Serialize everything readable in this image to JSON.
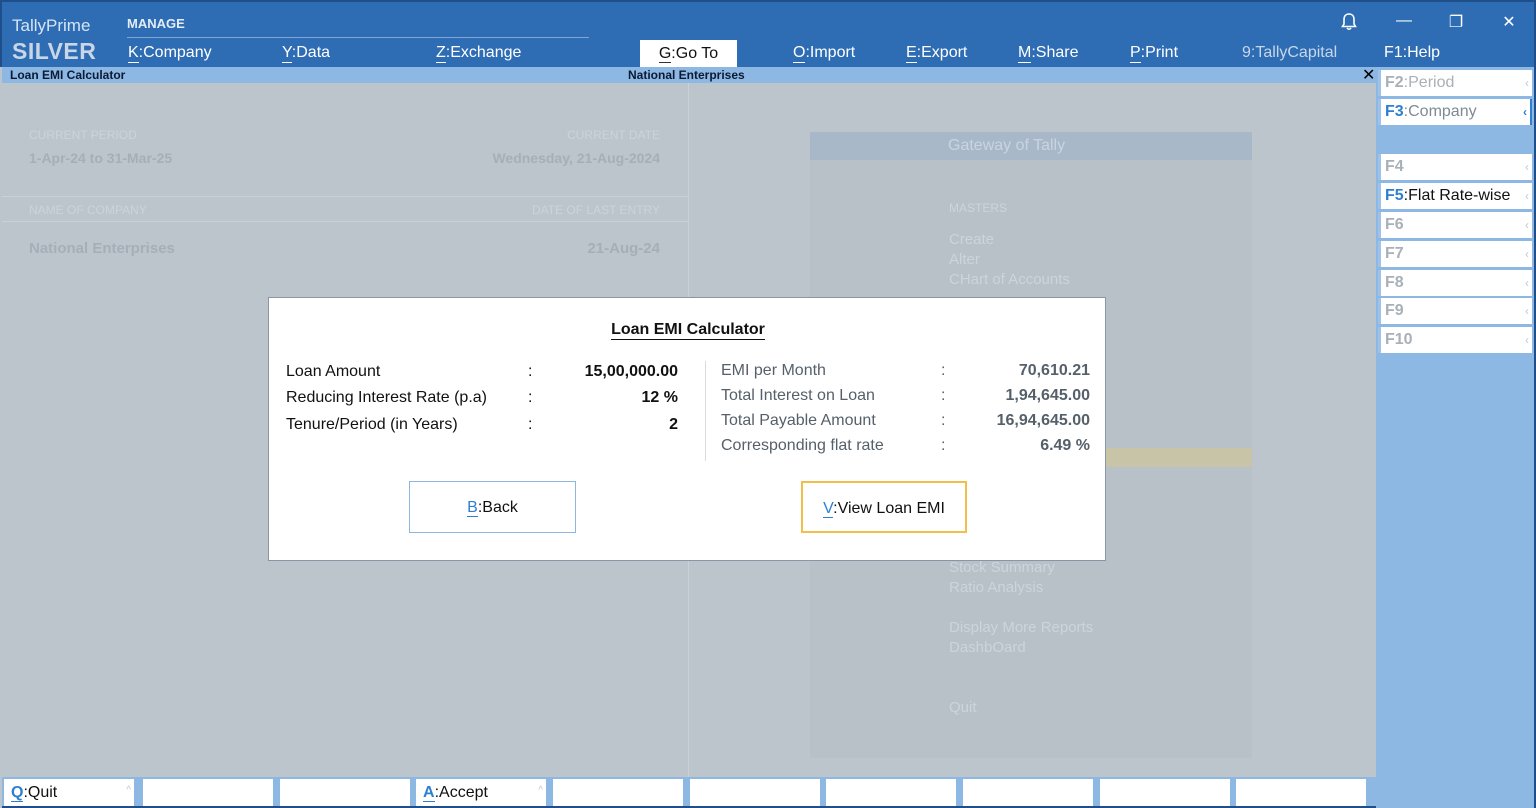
{
  "app": {
    "brand_line1": "TallyPrime",
    "brand_line2": "SILVER",
    "section_label": "MANAGE"
  },
  "menu": [
    {
      "key": "K",
      "label": "Company"
    },
    {
      "key": "Y",
      "label": "Data"
    },
    {
      "key": "Z",
      "label": "Exchange"
    },
    {
      "key": "G",
      "label": "Go To"
    },
    {
      "key": "O",
      "label": "Import"
    },
    {
      "key": "E",
      "label": "Export"
    },
    {
      "key": "M",
      "label": "Share"
    },
    {
      "key": "P",
      "label": "Print"
    },
    {
      "key": "9",
      "label": "TallyCapital"
    },
    {
      "key": "F1",
      "label": "Help"
    }
  ],
  "window": {
    "minimize": "—",
    "restore": "❐",
    "close": "✕"
  },
  "title_strip": {
    "screen_name": "Loan EMI Calculator",
    "company": "National Enterprises",
    "close": "✕"
  },
  "background": {
    "current_period_label": "CURRENT PERIOD",
    "current_period_value": "1-Apr-24 to 31-Mar-25",
    "current_date_label": "CURRENT DATE",
    "current_date_value": "Wednesday, 21-Aug-2024",
    "company_label": "NAME OF COMPANY",
    "company_value": "National Enterprises",
    "last_entry_label": "DATE OF LAST ENTRY",
    "last_entry_value": "21-Aug-24",
    "gateway": {
      "title": "Gateway of Tally",
      "masters_label": "MASTERS",
      "items_top": [
        "Create",
        "Alter",
        "CHart of Accounts"
      ],
      "items_bottom": [
        "Stock Summary",
        "Ratio Analysis"
      ],
      "items_more": [
        "Display More Reports",
        "DashbOard"
      ],
      "quit": "Quit"
    }
  },
  "sidebar": [
    {
      "key": "F2",
      "label": "Period"
    },
    {
      "key": "F3",
      "label": "Company"
    },
    {
      "key": "F4",
      "label": ""
    },
    {
      "key": "F5",
      "label": "Flat Rate-wise"
    },
    {
      "key": "F6",
      "label": ""
    },
    {
      "key": "F7",
      "label": ""
    },
    {
      "key": "F8",
      "label": ""
    },
    {
      "key": "F9",
      "label": ""
    },
    {
      "key": "F10",
      "label": ""
    }
  ],
  "bottom": [
    {
      "key": "Q",
      "label": "Quit"
    },
    {
      "key": "A",
      "label": "Accept"
    }
  ],
  "dialog": {
    "title": "Loan EMI Calculator",
    "inputs": [
      {
        "label": "Loan Amount",
        "value": "15,00,000.00"
      },
      {
        "label": "Reducing Interest Rate (p.a)",
        "value": "12 %"
      },
      {
        "label": "Tenure/Period (in Years)",
        "value": "2"
      }
    ],
    "results": [
      {
        "label": "EMI per Month",
        "value": "70,610.21"
      },
      {
        "label": "Total Interest on Loan",
        "value": "1,94,645.00"
      },
      {
        "label": "Total Payable Amount",
        "value": "16,94,645.00"
      },
      {
        "label": "Corresponding flat rate",
        "value": "6.49 %"
      }
    ],
    "colon": ":",
    "back": {
      "key": "B",
      "label": "Back"
    },
    "view": {
      "key": "V",
      "label": "View Loan EMI"
    }
  },
  "colors": {
    "header": "#2e6db4",
    "strip": "#8eb8e4",
    "accent": "#2f7fd0",
    "focus": "#f2c04a"
  }
}
